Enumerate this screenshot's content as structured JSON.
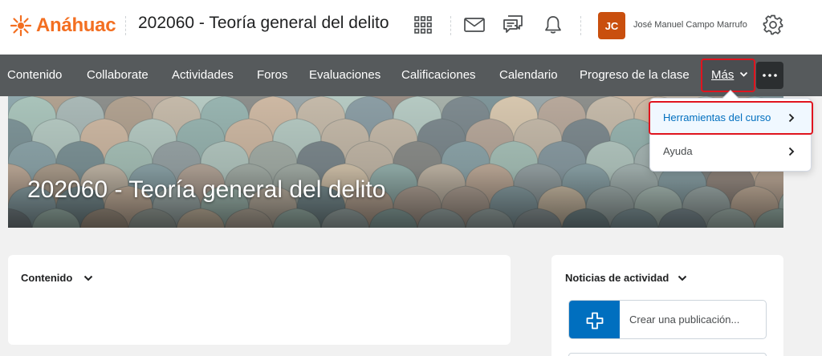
{
  "header": {
    "logo_text": "Anáhuac",
    "course_title": "202060 - Teoría general del delito",
    "avatar_initials": "JC",
    "user_name": "José Manuel Campo Marrufo",
    "icons": [
      "apps-grid-icon",
      "mail-icon",
      "chat-icon",
      "bell-icon",
      "gear-icon"
    ]
  },
  "nav": {
    "items": [
      "Contenido",
      "Collaborate",
      "Actividades",
      "Foros",
      "Evaluaciones",
      "Calificaciones",
      "Calendario",
      "Progreso de la clase"
    ],
    "more_label": "Más"
  },
  "banner": {
    "title": "202060 - Teoría general del delito"
  },
  "dropdown": {
    "items": [
      "Herramientas del curso",
      "Ayuda"
    ]
  },
  "widgets": {
    "content_title": "Contenido",
    "activity_title": "Noticias de actividad",
    "create_post": "Crear una publicación..."
  },
  "colors": {
    "brand_orange": "#f36f21",
    "nav_bg": "#565a5c",
    "highlight_red": "#e0141e",
    "primary_blue": "#006fbf",
    "avatar_bg": "#c94f0e"
  }
}
